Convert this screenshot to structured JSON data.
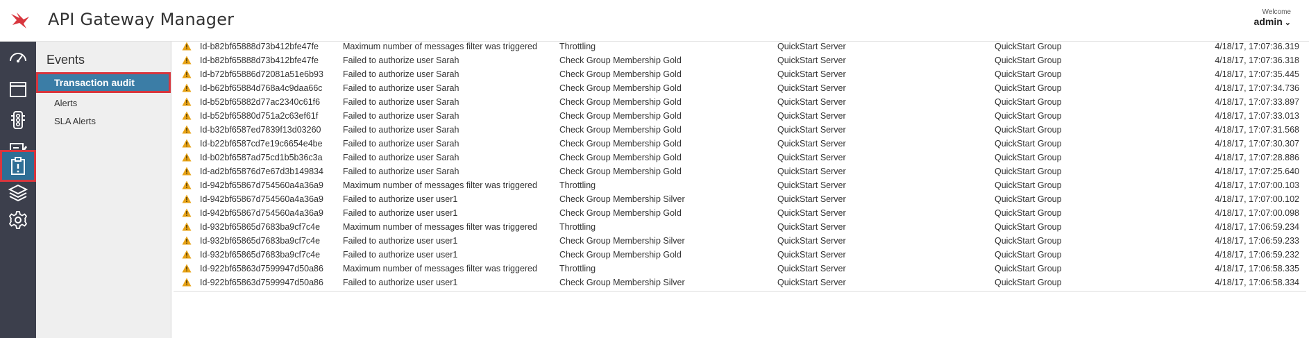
{
  "header": {
    "app_title": "API Gateway Manager",
    "welcome_label": "Welcome",
    "user": "admin",
    "brand_color": "#d8363e"
  },
  "iconbar": {
    "items": [
      {
        "name": "dashboard",
        "icon": "speedometer-icon"
      },
      {
        "name": "monitoring",
        "icon": "window-icon"
      },
      {
        "name": "traffic",
        "icon": "traffic-light-icon"
      },
      {
        "name": "logs",
        "icon": "edit-list-icon"
      },
      {
        "name": "events",
        "icon": "clipboard-alert-icon",
        "active": true
      },
      {
        "name": "topology",
        "icon": "layers-icon"
      },
      {
        "name": "settings",
        "icon": "gear-icon"
      }
    ]
  },
  "subnav": {
    "title": "Events",
    "items": [
      {
        "label": "Transaction audit",
        "active": true
      },
      {
        "label": "Alerts"
      },
      {
        "label": "SLA Alerts"
      }
    ]
  },
  "table": {
    "rows": [
      [
        "Id-b82bf65888d73b412bfe47fe",
        "Maximum number of messages filter was triggered",
        "Throttling",
        "QuickStart Server",
        "QuickStart Group",
        "4/18/17, 17:07:36.319"
      ],
      [
        "Id-b82bf65888d73b412bfe47fe",
        "Failed to authorize user Sarah",
        "Check Group Membership Gold",
        "QuickStart Server",
        "QuickStart Group",
        "4/18/17, 17:07:36.318"
      ],
      [
        "Id-b72bf65886d72081a51e6b93",
        "Failed to authorize user Sarah",
        "Check Group Membership Gold",
        "QuickStart Server",
        "QuickStart Group",
        "4/18/17, 17:07:35.445"
      ],
      [
        "Id-b62bf65884d768a4c9daa66c",
        "Failed to authorize user Sarah",
        "Check Group Membership Gold",
        "QuickStart Server",
        "QuickStart Group",
        "4/18/17, 17:07:34.736"
      ],
      [
        "Id-b52bf65882d77ac2340c61f6",
        "Failed to authorize user Sarah",
        "Check Group Membership Gold",
        "QuickStart Server",
        "QuickStart Group",
        "4/18/17, 17:07:33.897"
      ],
      [
        "Id-b52bf65880d751a2c63ef61f",
        "Failed to authorize user Sarah",
        "Check Group Membership Gold",
        "QuickStart Server",
        "QuickStart Group",
        "4/18/17, 17:07:33.013"
      ],
      [
        "Id-b32bf6587ed7839f13d03260",
        "Failed to authorize user Sarah",
        "Check Group Membership Gold",
        "QuickStart Server",
        "QuickStart Group",
        "4/18/17, 17:07:31.568"
      ],
      [
        "Id-b22bf6587cd7e19c6654e4be",
        "Failed to authorize user Sarah",
        "Check Group Membership Gold",
        "QuickStart Server",
        "QuickStart Group",
        "4/18/17, 17:07:30.307"
      ],
      [
        "Id-b02bf6587ad75cd1b5b36c3a",
        "Failed to authorize user Sarah",
        "Check Group Membership Gold",
        "QuickStart Server",
        "QuickStart Group",
        "4/18/17, 17:07:28.886"
      ],
      [
        "Id-ad2bf65876d7e67d3b149834",
        "Failed to authorize user Sarah",
        "Check Group Membership Gold",
        "QuickStart Server",
        "QuickStart Group",
        "4/18/17, 17:07:25.640"
      ],
      [
        "Id-942bf65867d754560a4a36a9",
        "Maximum number of messages filter was triggered",
        "Throttling",
        "QuickStart Server",
        "QuickStart Group",
        "4/18/17, 17:07:00.103"
      ],
      [
        "Id-942bf65867d754560a4a36a9",
        "Failed to authorize user user1",
        "Check Group Membership Silver",
        "QuickStart Server",
        "QuickStart Group",
        "4/18/17, 17:07:00.102"
      ],
      [
        "Id-942bf65867d754560a4a36a9",
        "Failed to authorize user user1",
        "Check Group Membership Gold",
        "QuickStart Server",
        "QuickStart Group",
        "4/18/17, 17:07:00.098"
      ],
      [
        "Id-932bf65865d7683ba9cf7c4e",
        "Maximum number of messages filter was triggered",
        "Throttling",
        "QuickStart Server",
        "QuickStart Group",
        "4/18/17, 17:06:59.234"
      ],
      [
        "Id-932bf65865d7683ba9cf7c4e",
        "Failed to authorize user user1",
        "Check Group Membership Silver",
        "QuickStart Server",
        "QuickStart Group",
        "4/18/17, 17:06:59.233"
      ],
      [
        "Id-932bf65865d7683ba9cf7c4e",
        "Failed to authorize user user1",
        "Check Group Membership Gold",
        "QuickStart Server",
        "QuickStart Group",
        "4/18/17, 17:06:59.232"
      ],
      [
        "Id-922bf65863d7599947d50a86",
        "Maximum number of messages filter was triggered",
        "Throttling",
        "QuickStart Server",
        "QuickStart Group",
        "4/18/17, 17:06:58.335"
      ],
      [
        "Id-922bf65863d7599947d50a86",
        "Failed to authorize user user1",
        "Check Group Membership Silver",
        "QuickStart Server",
        "QuickStart Group",
        "4/18/17, 17:06:58.334"
      ]
    ],
    "row_icon": "warning-icon",
    "warning_color": "#e8a317"
  }
}
